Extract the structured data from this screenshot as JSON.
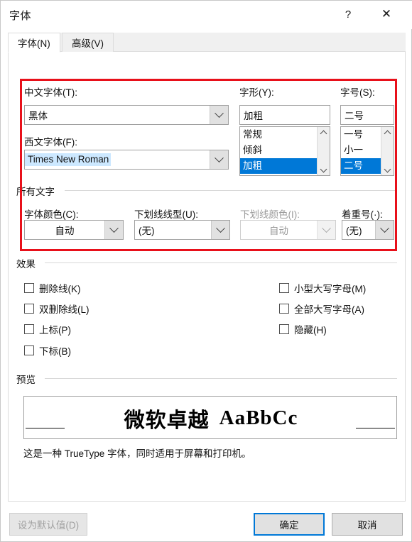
{
  "window": {
    "title": "字体",
    "help_icon": "?",
    "close_icon": "✕"
  },
  "tabs": [
    {
      "label": "字体(N)",
      "active": true
    },
    {
      "label": "高级(V)",
      "active": false
    }
  ],
  "font_section": {
    "chinese_font": {
      "label": "中文字体(T):",
      "value": "黑体"
    },
    "western_font": {
      "label": "西文字体(F):",
      "value": "Times New Roman",
      "selected": true
    },
    "font_style": {
      "label": "字形(Y):",
      "value": "加粗",
      "options": [
        "常规",
        "倾斜",
        "加粗"
      ],
      "selected_index": 2
    },
    "font_size": {
      "label": "字号(S):",
      "value": "二号",
      "options": [
        "一号",
        "小一",
        "二号"
      ],
      "selected_index": 2
    }
  },
  "all_text": {
    "group_label": "所有文字",
    "font_color": {
      "label": "字体颜色(C):",
      "value": "自动",
      "disabled": false
    },
    "underline_style": {
      "label": "下划线线型(U):",
      "value": "(无)",
      "disabled": false
    },
    "underline_color": {
      "label": "下划线颜色(I):",
      "value": "自动",
      "disabled": true
    },
    "emphasis_mark": {
      "label": "着重号(·):",
      "value": "(无)",
      "disabled": false
    }
  },
  "effects": {
    "group_label": "效果",
    "left": [
      {
        "label": "删除线(K)",
        "checked": false
      },
      {
        "label": "双删除线(L)",
        "checked": false
      },
      {
        "label": "上标(P)",
        "checked": false
      },
      {
        "label": "下标(B)",
        "checked": false
      }
    ],
    "right": [
      {
        "label": "小型大写字母(M)",
        "checked": false
      },
      {
        "label": "全部大写字母(A)",
        "checked": false
      },
      {
        "label": "隐藏(H)",
        "checked": false
      }
    ]
  },
  "preview": {
    "group_label": "预览",
    "sample_cn": "微软卓越",
    "sample_en": "AaBbCc",
    "note": "这是一种 TrueType 字体，同时适用于屏幕和打印机。"
  },
  "buttons": {
    "set_default": {
      "label": "设为默认值(D)",
      "disabled": true
    },
    "ok": {
      "label": "确定",
      "default": true
    },
    "cancel": {
      "label": "取消",
      "default": false
    }
  },
  "colors": {
    "highlight_rect": "#e8101a",
    "selection_blue": "#0078d7",
    "text_selection": "#cce8ff",
    "accent": "#0078d7"
  }
}
